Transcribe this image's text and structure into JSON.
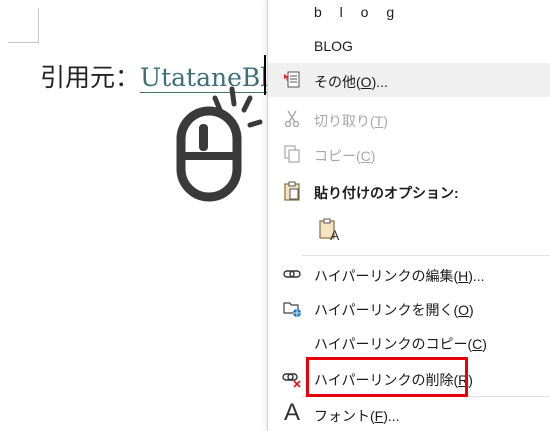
{
  "document": {
    "prefix": "引用元：",
    "link_text": "UtataneBl"
  },
  "context_menu": {
    "items": [
      {
        "label": "b l o g",
        "state": "normal"
      },
      {
        "label": "BLOG",
        "state": "normal"
      },
      {
        "label": "その他(O)...",
        "state": "hover"
      },
      {
        "label": "切り取り(T)",
        "state": "disabled"
      },
      {
        "label": "コピー(C)",
        "state": "disabled"
      },
      {
        "label": "貼り付けのオプション:",
        "state": "header"
      },
      {
        "label": "",
        "state": "paste-option"
      },
      {
        "label": "ハイパーリンクの編集(H)...",
        "state": "normal"
      },
      {
        "label": "ハイパーリンクを開く(O)",
        "state": "normal"
      },
      {
        "label": "ハイパーリンクのコピー(C)",
        "state": "normal"
      },
      {
        "label": "ハイパーリンクの削除(R)",
        "state": "highlighted"
      },
      {
        "label": "フォント(F)...",
        "state": "normal"
      }
    ]
  },
  "colors": {
    "highlight_border": "#e8000b",
    "link_color": "#3f6f78",
    "hover_bg": "#f0f0f0"
  }
}
